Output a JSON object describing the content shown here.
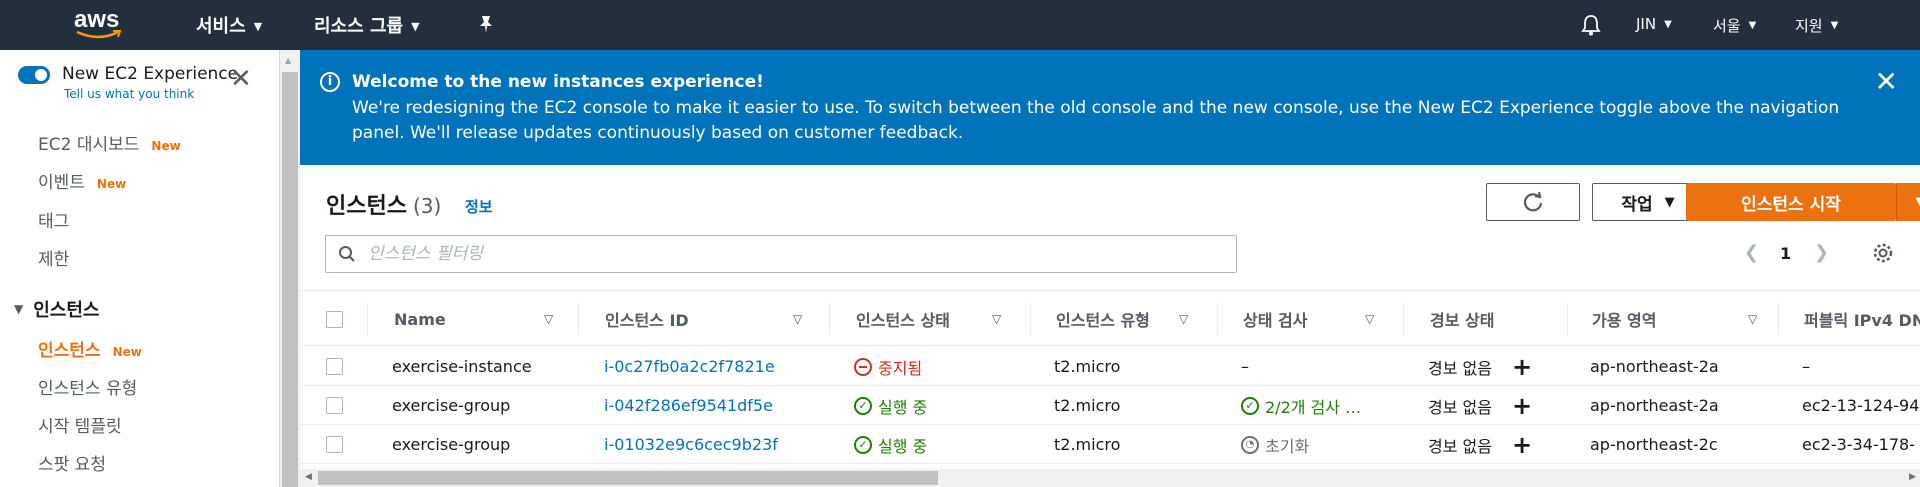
{
  "topnav": {
    "logo": "aws",
    "services": "서비스",
    "resource_groups": "리소스 그룹",
    "user": "JIN",
    "region": "서울",
    "support": "지원",
    "bell_icon": "bell-icon",
    "pin_icon": "pin-icon"
  },
  "sidebar": {
    "toggle_label": "New EC2 Experience",
    "toggle_link": "Tell us what you think",
    "items": [
      {
        "label": "EC2 대시보드",
        "badge": "New"
      },
      {
        "label": "이벤트",
        "badge": "New"
      },
      {
        "label": "태그",
        "badge": ""
      },
      {
        "label": "제한",
        "badge": ""
      }
    ],
    "section": "인스턴스",
    "section_items": [
      {
        "label": "인스턴스",
        "badge": "New",
        "active": true
      },
      {
        "label": "인스턴스 유형",
        "badge": ""
      },
      {
        "label": "시작 템플릿",
        "badge": ""
      },
      {
        "label": "스팟 요청",
        "badge": ""
      }
    ]
  },
  "banner": {
    "title": "Welcome to the new instances experience!",
    "body": "We're redesigning the EC2 console to make it easier to use. To switch between the old console and the new console, use the New EC2 Experience toggle above the navigation panel. We'll release updates continuously based on customer feedback."
  },
  "panel": {
    "title": "인스턴스",
    "count": "(3)",
    "info": "정보",
    "actions_label": "작업",
    "launch_label": "인스턴스 시작",
    "search_placeholder": "인스턴스 필터링",
    "page": "1"
  },
  "table": {
    "columns": [
      "Name",
      "인스턴스 ID",
      "인스턴스 상태",
      "인스턴스 유형",
      "상태 검사",
      "경보 상태",
      "가용 영역",
      "퍼블릭 IPv4 DN"
    ],
    "rows": [
      {
        "name": "exercise-instance",
        "id": "i-0c27fb0a2c2f7821e",
        "state": "중지됨",
        "state_kind": "stopped",
        "type": "t2.micro",
        "check": "–",
        "check_kind": "none",
        "alarm": "경보 없음",
        "az": "ap-northeast-2a",
        "dns": "–"
      },
      {
        "name": "exercise-group",
        "id": "i-042f286ef9541df5e",
        "state": "실행 중",
        "state_kind": "running",
        "type": "t2.micro",
        "check": "2/2개 검사 …",
        "check_kind": "ok",
        "alarm": "경보 없음",
        "az": "ap-northeast-2a",
        "dns": "ec2-13-124-94"
      },
      {
        "name": "exercise-group",
        "id": "i-01032e9c6cec9b23f",
        "state": "실행 중",
        "state_kind": "running",
        "type": "t2.micro",
        "check": "초기화",
        "check_kind": "init",
        "alarm": "경보 없음",
        "az": "ap-northeast-2c",
        "dns": "ec2-3-34-178-"
      }
    ]
  },
  "colors": {
    "nav_bg": "#232f3e",
    "banner_bg": "#0073bb",
    "accent": "#ec7211",
    "link": "#0073bb"
  }
}
